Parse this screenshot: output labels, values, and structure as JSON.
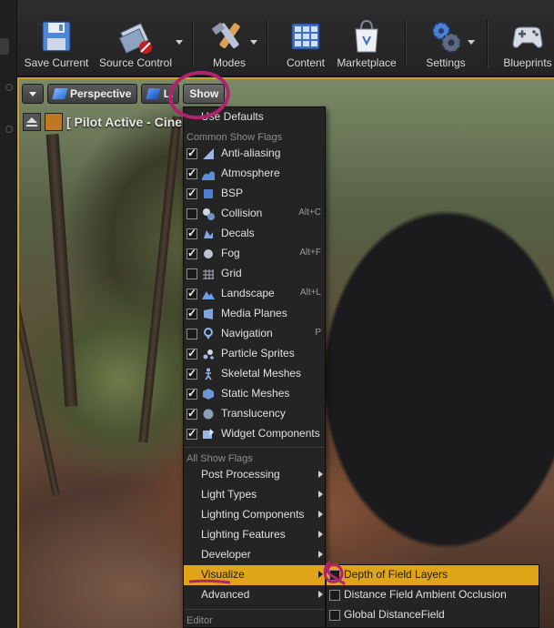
{
  "toolbar": {
    "buttons": [
      {
        "label": "Save Current",
        "icon": "floppy-disk-icon"
      },
      {
        "label": "Source Control",
        "icon": "source-control-icon"
      },
      {
        "label": "Modes",
        "icon": "modes-tools-icon"
      },
      {
        "label": "Content",
        "icon": "content-grid-icon"
      },
      {
        "label": "Marketplace",
        "icon": "marketplace-bag-icon"
      },
      {
        "label": "Settings",
        "icon": "settings-gears-icon"
      },
      {
        "label": "Blueprints",
        "icon": "blueprints-gamepad-icon"
      }
    ]
  },
  "viewport": {
    "perspective_label": "Perspective",
    "lit_label": "Li",
    "show_label": "Show",
    "pilot_label": "[ Pilot Active - Cine"
  },
  "menu": {
    "use_defaults": "Use Defaults",
    "common_header": "Common Show Flags",
    "common_flags": [
      {
        "label": "Anti-aliasing",
        "checked": true,
        "shortcut": "",
        "icon": "anti-aliasing-icon"
      },
      {
        "label": "Atmosphere",
        "checked": true,
        "shortcut": "",
        "icon": "atmosphere-icon"
      },
      {
        "label": "BSP",
        "checked": true,
        "shortcut": "",
        "icon": "bsp-icon"
      },
      {
        "label": "Collision",
        "checked": false,
        "shortcut": "Alt+C",
        "icon": "collision-icon"
      },
      {
        "label": "Decals",
        "checked": true,
        "shortcut": "",
        "icon": "decals-icon"
      },
      {
        "label": "Fog",
        "checked": true,
        "shortcut": "Alt+F",
        "icon": "fog-icon"
      },
      {
        "label": "Grid",
        "checked": false,
        "shortcut": "",
        "icon": "grid-icon"
      },
      {
        "label": "Landscape",
        "checked": true,
        "shortcut": "Alt+L",
        "icon": "landscape-icon"
      },
      {
        "label": "Media Planes",
        "checked": true,
        "shortcut": "",
        "icon": "media-planes-icon"
      },
      {
        "label": "Navigation",
        "checked": false,
        "shortcut": "P",
        "icon": "navigation-icon"
      },
      {
        "label": "Particle Sprites",
        "checked": true,
        "shortcut": "",
        "icon": "particle-sprites-icon"
      },
      {
        "label": "Skeletal Meshes",
        "checked": true,
        "shortcut": "",
        "icon": "skeletal-meshes-icon"
      },
      {
        "label": "Static Meshes",
        "checked": true,
        "shortcut": "",
        "icon": "static-meshes-icon"
      },
      {
        "label": "Translucency",
        "checked": true,
        "shortcut": "",
        "icon": "translucency-icon"
      },
      {
        "label": "Widget Components",
        "checked": true,
        "shortcut": "",
        "icon": "widget-components-icon"
      }
    ],
    "all_header": "All Show Flags",
    "all_flags": [
      {
        "label": "Post Processing",
        "highlighted": false
      },
      {
        "label": "Light Types",
        "highlighted": false
      },
      {
        "label": "Lighting Components",
        "highlighted": false
      },
      {
        "label": "Lighting Features",
        "highlighted": false
      },
      {
        "label": "Developer",
        "highlighted": false
      },
      {
        "label": "Visualize",
        "highlighted": true
      },
      {
        "label": "Advanced",
        "highlighted": false
      }
    ],
    "editor_header": "Editor"
  },
  "submenu": {
    "items": [
      {
        "label": "Depth of Field Layers",
        "checked": false,
        "highlighted": true
      },
      {
        "label": "Distance Field Ambient Occlusion",
        "checked": false,
        "highlighted": false
      },
      {
        "label": "Global DistanceField",
        "checked": false,
        "highlighted": false
      }
    ]
  },
  "colors": {
    "highlight": "#e0a419",
    "annotation": "#b0246e"
  }
}
